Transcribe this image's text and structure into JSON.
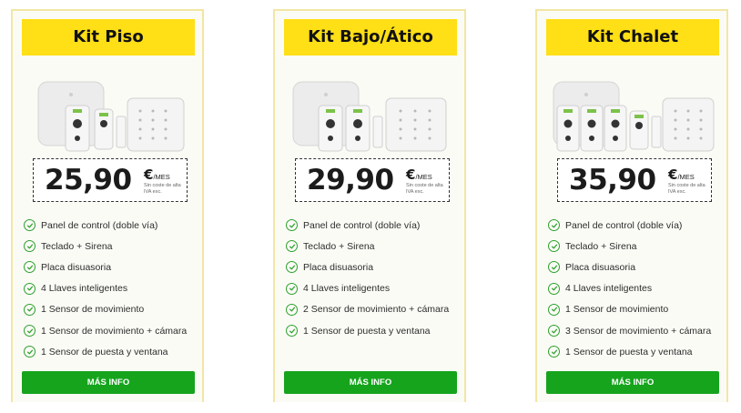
{
  "colors": {
    "title_bg": "#ffdf16",
    "button_bg": "#16a41d",
    "check": "#2ea12e",
    "card_border": "#f2e6a4"
  },
  "kits": [
    {
      "title": "Kit Piso",
      "price": "25,90",
      "currency": "€",
      "period": "/MES",
      "note": "Sin coste de alta IVA exc.",
      "features": [
        "Panel de control (doble vía)",
        "Teclado + Sirena",
        "Placa disuasoria",
        "4 Llaves inteligentes",
        "1 Sensor de movimiento",
        "1 Sensor de movimiento + cámara",
        "1 Sensor de puesta y ventana"
      ],
      "button": "MÁS INFO",
      "icons": [
        "check-circle-icon"
      ]
    },
    {
      "title": "Kit Bajo/Ático",
      "price": "29,90",
      "currency": "€",
      "period": "/MES",
      "note": "Sin coste de alta IVA exc.",
      "features": [
        "Panel de control (doble vía)",
        "Teclado + Sirena",
        "Placa disuasoria",
        "4 Llaves inteligentes",
        "2 Sensor de movimiento + cámara",
        "1 Sensor de puesta y ventana"
      ],
      "button": "MÁS INFO",
      "icons": [
        "check-circle-icon"
      ]
    },
    {
      "title": "Kit Chalet",
      "price": "35,90",
      "currency": "€",
      "period": "/MES",
      "note": "Sin coste de alta IVA exc.",
      "features": [
        "Panel de control (doble vía)",
        "Teclado + Sirena",
        "Placa disuasoria",
        "4 Llaves inteligentes",
        "1 Sensor de movimiento",
        "3 Sensor de movimiento + cámara",
        "1 Sensor de puesta y ventana"
      ],
      "button": "MÁS INFO",
      "icons": [
        "check-circle-icon"
      ]
    }
  ]
}
